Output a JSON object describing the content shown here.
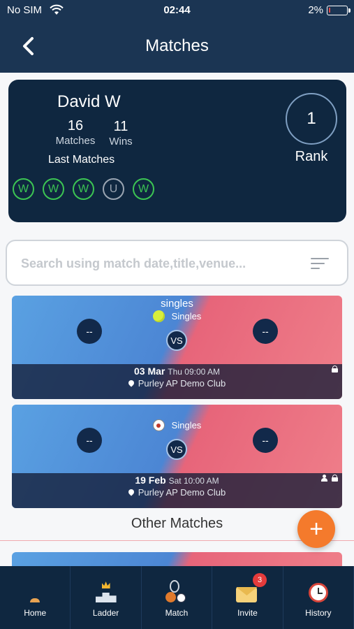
{
  "status": {
    "carrier": "No SIM",
    "time": "02:44",
    "battery": "2%"
  },
  "nav": {
    "title": "Matches"
  },
  "profile": {
    "name": "David W",
    "matches_count": "16",
    "matches_label": "Matches",
    "wins_count": "11",
    "wins_label": "Wins",
    "last_matches_label": "Last Matches",
    "results": [
      "W",
      "W",
      "W",
      "U",
      "W"
    ],
    "rank": "1",
    "rank_label": "Rank"
  },
  "search": {
    "placeholder": "Search using match date,title,venue..."
  },
  "matches": [
    {
      "title": "singles",
      "sport_label": "Singles",
      "sport_icon": "tennis-ball-icon",
      "player1": "--",
      "player2": "--",
      "vs": "VS",
      "date": "03 Mar",
      "day_time": "Thu 09:00 AM",
      "venue": "Purley AP Demo Club"
    },
    {
      "title": "",
      "sport_label": "Singles",
      "sport_icon": "football-icon",
      "player1": "--",
      "player2": "--",
      "vs": "VS",
      "date": "19 Feb",
      "day_time": "Sat 10:00 AM",
      "venue": "Purley AP Demo Club"
    }
  ],
  "other_matches_title": "Other Matches",
  "fab_label": "+",
  "tabs": [
    {
      "label": "Home",
      "icon": "home-icon"
    },
    {
      "label": "Ladder",
      "icon": "ladder-icon"
    },
    {
      "label": "Match",
      "icon": "match-icon"
    },
    {
      "label": "Invite",
      "icon": "invite-icon",
      "badge": "3"
    },
    {
      "label": "History",
      "icon": "history-icon"
    }
  ],
  "colors": {
    "header": "#1b3553",
    "card": "#0f2740",
    "win": "#3cc553",
    "accent": "#f47a2c",
    "blue": "#5aa1e2",
    "pink": "#e7657a"
  }
}
